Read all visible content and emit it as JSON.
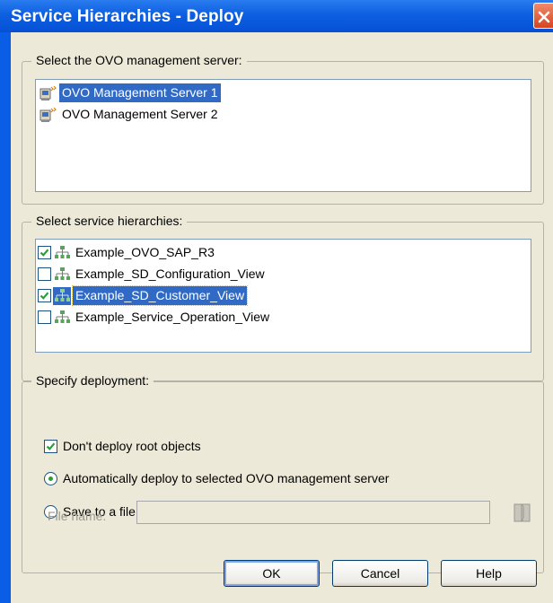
{
  "window": {
    "title": "Service Hierarchies - Deploy"
  },
  "server_group": {
    "legend": "Select the OVO management server:",
    "items": [
      {
        "label": "OVO Management Server 1",
        "selected": true
      },
      {
        "label": "OVO Management Server 2",
        "selected": false
      }
    ]
  },
  "hierarchy_group": {
    "legend": "Select service hierarchies:",
    "items": [
      {
        "label": "Example_OVO_SAP_R3",
        "checked": true
      },
      {
        "label": "Example_SD_Configuration_View",
        "checked": false
      },
      {
        "label": "Example_SD_Customer_View",
        "checked": true
      },
      {
        "label": "Example_Service_Operation_View",
        "checked": false
      }
    ]
  },
  "deployment_group": {
    "legend": "Specify deployment:",
    "dont_deploy_root": {
      "label": "Don't deploy root objects",
      "checked": true
    },
    "auto_deploy": {
      "label": "Automatically deploy to selected OVO management server",
      "selected": true
    },
    "save_to_file": {
      "label": "Save to a file and manually import configuration to OVO",
      "selected": false
    },
    "file_name": {
      "label": "File name:",
      "value": ""
    }
  },
  "buttons": {
    "ok": "OK",
    "cancel": "Cancel",
    "help": "Help"
  },
  "colors": {
    "title_bar": "#0a5ee6",
    "selection": "#316ac5",
    "checkmark": "#2a9d3a",
    "dialog_bg": "#ece9d8"
  }
}
